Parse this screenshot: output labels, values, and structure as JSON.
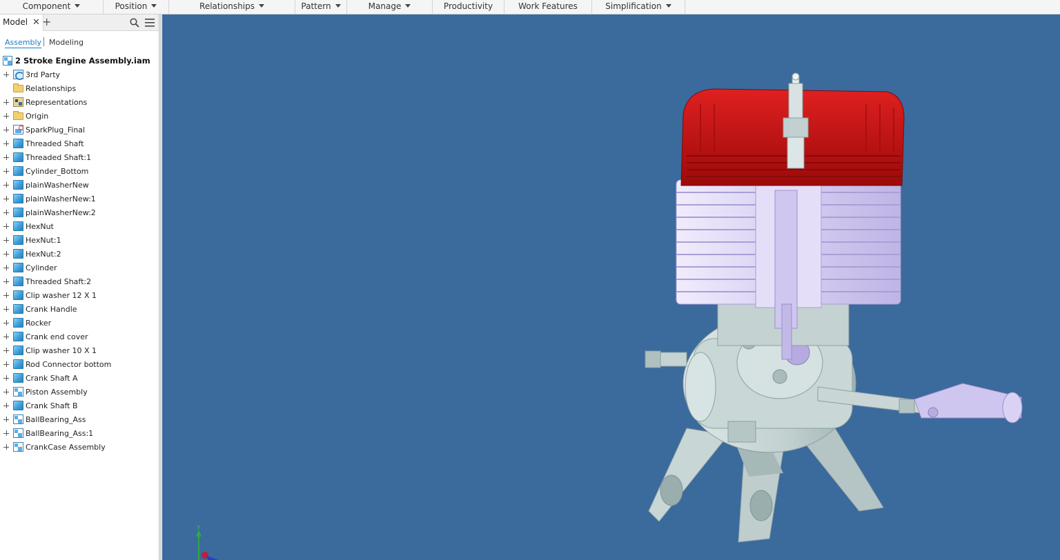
{
  "ribbon": {
    "tabs": [
      {
        "label": "Component",
        "dropdown": true
      },
      {
        "label": "Position",
        "dropdown": true
      },
      {
        "label": "Relationships",
        "dropdown": true
      },
      {
        "label": "Pattern",
        "dropdown": true
      },
      {
        "label": "Manage",
        "dropdown": true
      },
      {
        "label": "Productivity",
        "dropdown": false
      },
      {
        "label": "Work Features",
        "dropdown": false
      },
      {
        "label": "Simplification",
        "dropdown": true
      }
    ]
  },
  "browser": {
    "tab_label": "Model",
    "close_glyph": "✕",
    "add_glyph": "+",
    "mode_assembly": "Assembly",
    "mode_modeling": "Modeling",
    "root": {
      "label": "2 Stroke Engine Assembly.iam",
      "icon": "assembly-icon"
    },
    "items": [
      {
        "label": "3rd Party",
        "icon": "third-party-icon"
      },
      {
        "label": "Relationships",
        "icon": "folder-icon"
      },
      {
        "label": "Representations",
        "icon": "representations-icon"
      },
      {
        "label": "Origin",
        "icon": "folder-icon"
      },
      {
        "label": "SparkPlug_Final",
        "icon": "sparkplug-icon"
      },
      {
        "label": "Threaded Shaft",
        "icon": "part-icon"
      },
      {
        "label": "Threaded Shaft:1",
        "icon": "part-icon"
      },
      {
        "label": "Cylinder_Bottom",
        "icon": "part-icon"
      },
      {
        "label": "plainWasherNew",
        "icon": "part-icon"
      },
      {
        "label": "plainWasherNew:1",
        "icon": "part-icon"
      },
      {
        "label": "plainWasherNew:2",
        "icon": "part-icon"
      },
      {
        "label": "HexNut",
        "icon": "part-icon"
      },
      {
        "label": "HexNut:1",
        "icon": "part-icon"
      },
      {
        "label": "HexNut:2",
        "icon": "part-icon"
      },
      {
        "label": "Cylinder",
        "icon": "part-icon"
      },
      {
        "label": "Threaded Shaft:2",
        "icon": "part-icon"
      },
      {
        "label": "Clip washer 12 X 1",
        "icon": "part-icon"
      },
      {
        "label": "Crank Handle",
        "icon": "part-icon"
      },
      {
        "label": "Rocker",
        "icon": "part-icon"
      },
      {
        "label": "Crank end cover",
        "icon": "part-icon"
      },
      {
        "label": "Clip washer 10 X 1",
        "icon": "part-icon"
      },
      {
        "label": "Rod Connector bottom",
        "icon": "part-icon"
      },
      {
        "label": "Crank Shaft A",
        "icon": "part-icon"
      },
      {
        "label": "Piston Assembly",
        "icon": "assembly-icon"
      },
      {
        "label": "Crank Shaft B",
        "icon": "part-icon"
      },
      {
        "label": "BallBearing_Ass",
        "icon": "assembly-icon"
      },
      {
        "label": "BallBearing_Ass:1",
        "icon": "assembly-icon"
      },
      {
        "label": "CrankCase Assembly",
        "icon": "assembly-icon"
      }
    ]
  },
  "viewport": {
    "axis_label_y": "Y",
    "colors": {
      "background": "#3b6a9c",
      "cylinder_head": "#c41414",
      "cylinder_fins": "#d7d0f0",
      "crankcase": "#c5d3d3"
    }
  }
}
